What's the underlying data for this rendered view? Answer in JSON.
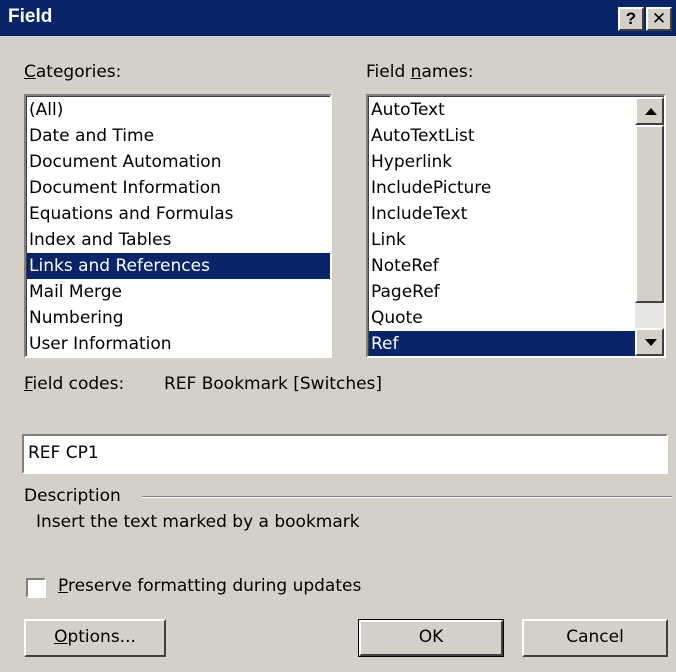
{
  "dialog": {
    "title": "Field",
    "help_button": "?",
    "close_button": "✕"
  },
  "categories": {
    "label_hotkey": "C",
    "label_rest": "ategories:",
    "items": [
      "(All)",
      "Date and Time",
      "Document Automation",
      "Document Information",
      "Equations and Formulas",
      "Index and Tables",
      "Links and References",
      "Mail Merge",
      "Numbering",
      "User Information"
    ],
    "selected": "Links and References"
  },
  "field_names": {
    "label_pre": "Field ",
    "label_hotkey": "n",
    "label_rest": "ames:",
    "items": [
      "AutoText",
      "AutoTextList",
      "Hyperlink",
      "IncludePicture",
      "IncludeText",
      "Link",
      "NoteRef",
      "PageRef",
      "Quote",
      "Ref"
    ],
    "selected": "Ref"
  },
  "field_codes": {
    "label_hotkey": "F",
    "label_rest": "ield codes:",
    "syntax": "REF Bookmark [Switches]",
    "value": "REF CP1"
  },
  "description": {
    "heading": "Description",
    "text": "Insert the text marked by a bookmark"
  },
  "preserve": {
    "label_hotkey": "P",
    "label_rest": "reserve formatting during updates",
    "checked": false
  },
  "buttons": {
    "options_hotkey": "O",
    "options_rest": "ptions...",
    "ok": "OK",
    "cancel": "Cancel"
  },
  "colors": {
    "face": "#d4d0c8",
    "titlebar": "#0a246a",
    "selection": "#0a246a"
  }
}
